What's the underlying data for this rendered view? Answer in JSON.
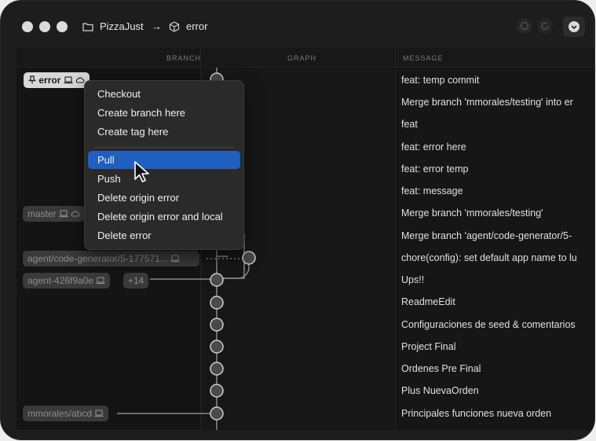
{
  "window": {
    "repo_name": "PizzaJust",
    "arrow": "→",
    "current_branch": "error"
  },
  "columns": {
    "branch": "BRANCH",
    "graph": "GRAPH",
    "message": "MESSAGE"
  },
  "branches": {
    "error": "error",
    "master": "master",
    "agent_code": "agent/code-generator/5-177571...",
    "agent_426": "agent-426f9a0e",
    "agent_426_more": "+14",
    "mmorales_abcd": "mmorales/abcd"
  },
  "context_menu": {
    "items": [
      "Checkout",
      "Create branch here",
      "Create tag here"
    ],
    "items2": [
      "Pull",
      "Push",
      "Delete origin error",
      "Delete origin error and local",
      "Delete error"
    ],
    "highlighted": "Pull"
  },
  "commits": [
    "feat: temp commit",
    "Merge branch 'mmorales/testing' into er",
    "feat",
    "feat: error here",
    "feat: error temp",
    "feat: message",
    "Merge branch 'mmorales/testing'",
    "Merge branch 'agent/code-generator/5-",
    "chore(config): set default app name to lu",
    "Ups!!",
    "ReadmeEdit",
    "Configuraciones de seed & comentarios",
    "Project Final",
    "Ordenes Pre Final",
    "Plus NuevaOrden",
    "Principales funciones nueva orden"
  ],
  "icons": {
    "folder": "folder-icon",
    "cube": "cube-icon",
    "tag_pin": "pin-icon",
    "laptop": "laptop-icon",
    "cloud": "cloud-icon",
    "cursor": "cursor-icon"
  }
}
